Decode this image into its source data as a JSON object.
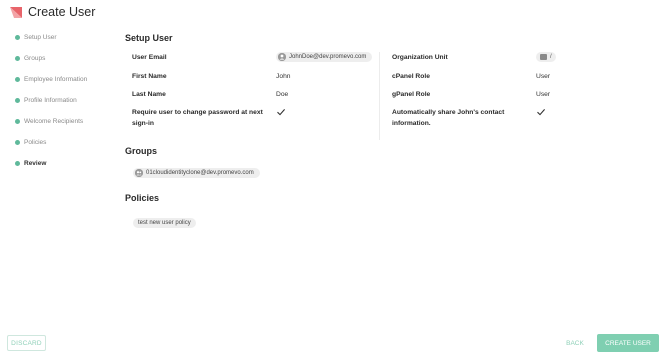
{
  "header": {
    "title": "Create User"
  },
  "stepper": {
    "steps": [
      {
        "label": "Setup User"
      },
      {
        "label": "Groups"
      },
      {
        "label": "Employee Information"
      },
      {
        "label": "Profile Information"
      },
      {
        "label": "Welcome Recipients"
      },
      {
        "label": "Policies"
      },
      {
        "label": "Review"
      }
    ],
    "active_step": "Review"
  },
  "setup_user": {
    "title": "Setup User",
    "user_email_label": "User Email",
    "user_email_value": "JohnDoe@dev.promevo.com",
    "first_name_label": "First Name",
    "first_name_value": "John",
    "last_name_label": "Last Name",
    "last_name_value": "Doe",
    "require_change_label": "Require user to change password at next sign-in",
    "org_unit_label": "Organization Unit",
    "org_unit_value": "/",
    "cpanel_role_label": "cPanel Role",
    "cpanel_role_value": "User",
    "gpanel_role_label": "gPanel Role",
    "gpanel_role_value": "User",
    "share_contact_label": "Automatically share John's contact information."
  },
  "groups": {
    "title": "Groups",
    "items": [
      "01cloudidentityclone@dev.promevo.com"
    ]
  },
  "policies": {
    "title": "Policies",
    "items": [
      "test new user policy"
    ]
  },
  "footer": {
    "discard_label": "DISCARD",
    "back_label": "BACK",
    "create_label": "CREATE USER"
  },
  "colors": {
    "accent": "#7fcfb1",
    "step_dot": "#5fb99b",
    "logo": "#e8646a"
  }
}
